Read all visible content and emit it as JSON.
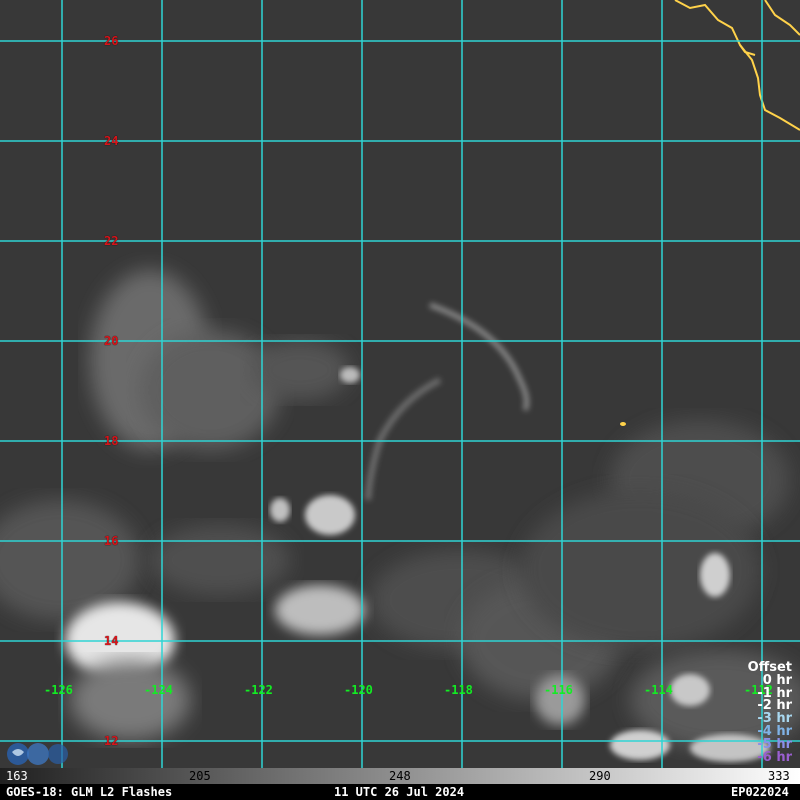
{
  "map": {
    "latitude_labels": [
      "26",
      "24",
      "22",
      "20",
      "18",
      "16",
      "14",
      "12"
    ],
    "longitude_labels": [
      "-126",
      "-124",
      "-122",
      "-120",
      "-118",
      "-116",
      "-114",
      "-112"
    ],
    "colors": {
      "grid": "#2fd4d4",
      "coastline": "#ffd24a",
      "lat_label": "#d8141a",
      "lon_label": "#11ee22",
      "flash": "#ffd24a"
    }
  },
  "offset_legend": {
    "title": "Offset",
    "entries": [
      {
        "label": "0 hr",
        "color": "#ffffff"
      },
      {
        "label": "-1 hr",
        "color": "#ffffff"
      },
      {
        "label": "-2 hr",
        "color": "#ffffff"
      },
      {
        "label": "-3 hr",
        "color": "#a9d8f0"
      },
      {
        "label": "-4 hr",
        "color": "#7fb3e6"
      },
      {
        "label": "-5 hr",
        "color": "#8a8fe8"
      },
      {
        "label": "-6 hr",
        "color": "#9a5fd0"
      }
    ]
  },
  "colorbar": {
    "ticks": [
      "163",
      "205",
      "248",
      "290",
      "333"
    ]
  },
  "footer": {
    "left": "GOES-18: GLM L2 Flashes",
    "center": "11 UTC 26 Jul 2024",
    "right": "EP022024"
  }
}
